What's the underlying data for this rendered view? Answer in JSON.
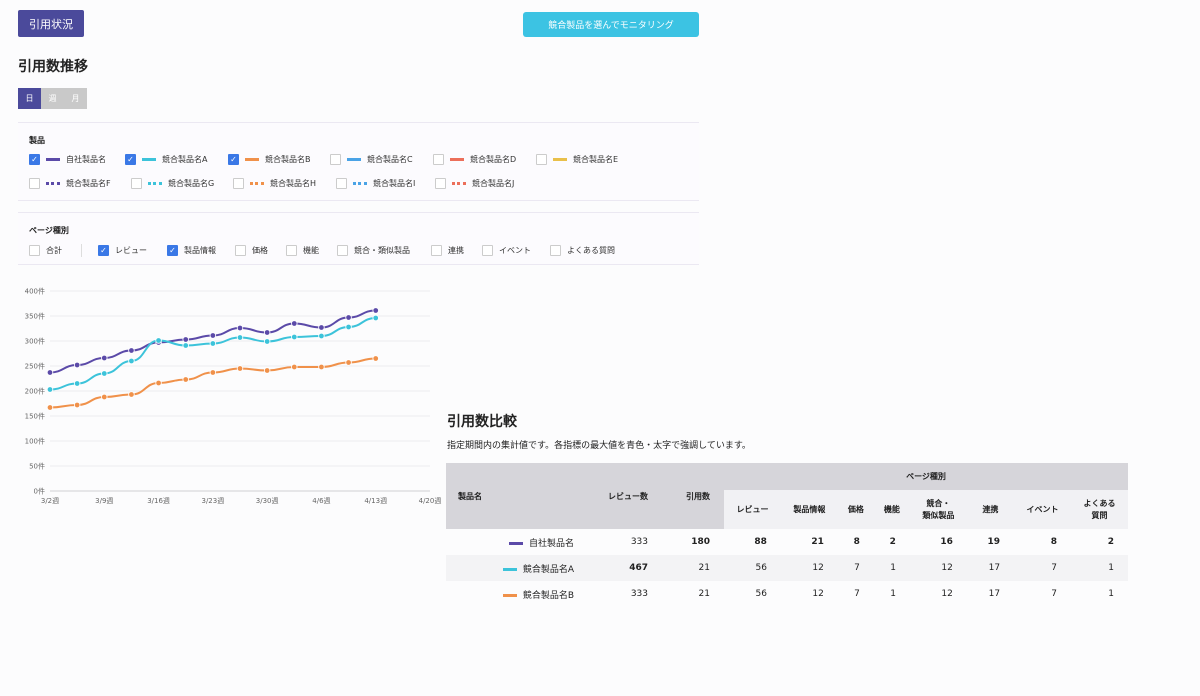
{
  "header": {
    "tag_label": "引用状況",
    "monitor_button": "競合製品を選んでモニタリング"
  },
  "trend": {
    "title": "引用数推移",
    "period_tabs": [
      {
        "label": "日",
        "active": true
      },
      {
        "label": "週",
        "active": false
      },
      {
        "label": "月",
        "active": false
      }
    ]
  },
  "products_panel": {
    "label": "製品",
    "items": [
      {
        "label": "自社製品名",
        "checked": true,
        "color": "#5b4aa8",
        "style": "solid"
      },
      {
        "label": "競合製品名A",
        "checked": true,
        "color": "#3cc3da",
        "style": "solid"
      },
      {
        "label": "競合製品名B",
        "checked": true,
        "color": "#f0914a",
        "style": "solid"
      },
      {
        "label": "競合製品名C",
        "checked": false,
        "color": "#4aa3e6",
        "style": "solid"
      },
      {
        "label": "競合製品名D",
        "checked": false,
        "color": "#ec6f5a",
        "style": "solid"
      },
      {
        "label": "競合製品名E",
        "checked": false,
        "color": "#e9c04a",
        "style": "solid"
      },
      {
        "label": "競合製品名F",
        "checked": false,
        "color": "#5b4aa8",
        "style": "dotted"
      },
      {
        "label": "競合製品名G",
        "checked": false,
        "color": "#3cc3da",
        "style": "dotted"
      },
      {
        "label": "競合製品名H",
        "checked": false,
        "color": "#f0914a",
        "style": "dotted"
      },
      {
        "label": "競合製品名I",
        "checked": false,
        "color": "#4aa3e6",
        "style": "dotted"
      },
      {
        "label": "競合製品名J",
        "checked": false,
        "color": "#ec6f5a",
        "style": "dotted"
      }
    ]
  },
  "page_type_panel": {
    "label": "ページ種別",
    "items": [
      {
        "label": "合計",
        "checked": false
      },
      {
        "label": "レビュー",
        "checked": true
      },
      {
        "label": "製品情報",
        "checked": true
      },
      {
        "label": "価格",
        "checked": false
      },
      {
        "label": "機能",
        "checked": false
      },
      {
        "label": "競合・類似製品",
        "checked": false
      },
      {
        "label": "連携",
        "checked": false
      },
      {
        "label": "イベント",
        "checked": false
      },
      {
        "label": "よくある質問",
        "checked": false
      }
    ]
  },
  "chart_data": {
    "type": "line",
    "x": [
      "3/2週",
      "3/9週",
      "3/16週",
      "3/23週",
      "3/30週",
      "4/6週",
      "4/13週",
      "4/20週"
    ],
    "ylim": [
      0,
      400
    ],
    "y_ticks": [
      "0件",
      "50件",
      "100件",
      "150件",
      "200件",
      "250件",
      "300件",
      "350件",
      "400件"
    ],
    "grid": true,
    "series": [
      {
        "name": "自社製品名",
        "color": "#5b4aa8",
        "values": [
          237,
          252,
          266,
          281,
          297,
          303,
          311,
          326,
          317,
          335,
          327,
          347,
          361
        ]
      },
      {
        "name": "競合製品名A",
        "color": "#3cc3da",
        "values": [
          203,
          215,
          235,
          260,
          301,
          291,
          295,
          307,
          299,
          308,
          310,
          328,
          346
        ]
      },
      {
        "name": "競合製品名B",
        "color": "#f0914a",
        "values": [
          167,
          172,
          188,
          193,
          216,
          223,
          237,
          245,
          241,
          248,
          248,
          257,
          265
        ]
      }
    ]
  },
  "comparison": {
    "title": "引用数比較",
    "description": "指定期間内の集計値です。各指標の最大値を青色・太字で強調しています。",
    "group_header": "ページ種別",
    "columns": {
      "name": "製品名",
      "reviews": "レビュー数",
      "citations": "引用数"
    },
    "sub_columns": [
      "レビュー",
      "製品情報",
      "価格",
      "機能",
      "競合・\n類似製品",
      "連携",
      "イベント",
      "よくある\n質問"
    ],
    "rows": [
      {
        "name": "自社製品名",
        "color": "#5b4aa8",
        "reviews": "333",
        "citations": "180",
        "values": [
          "88",
          "21",
          "8",
          "2",
          "16",
          "19",
          "8",
          "2"
        ]
      },
      {
        "name": "競合製品名A",
        "color": "#3cc3da",
        "reviews": "467",
        "citations": "21",
        "values": [
          "56",
          "12",
          "7",
          "1",
          "12",
          "17",
          "7",
          "1"
        ]
      },
      {
        "name": "競合製品名B",
        "color": "#f0914a",
        "reviews": "333",
        "citations": "21",
        "values": [
          "56",
          "12",
          "7",
          "1",
          "12",
          "17",
          "7",
          "1"
        ]
      }
    ]
  }
}
